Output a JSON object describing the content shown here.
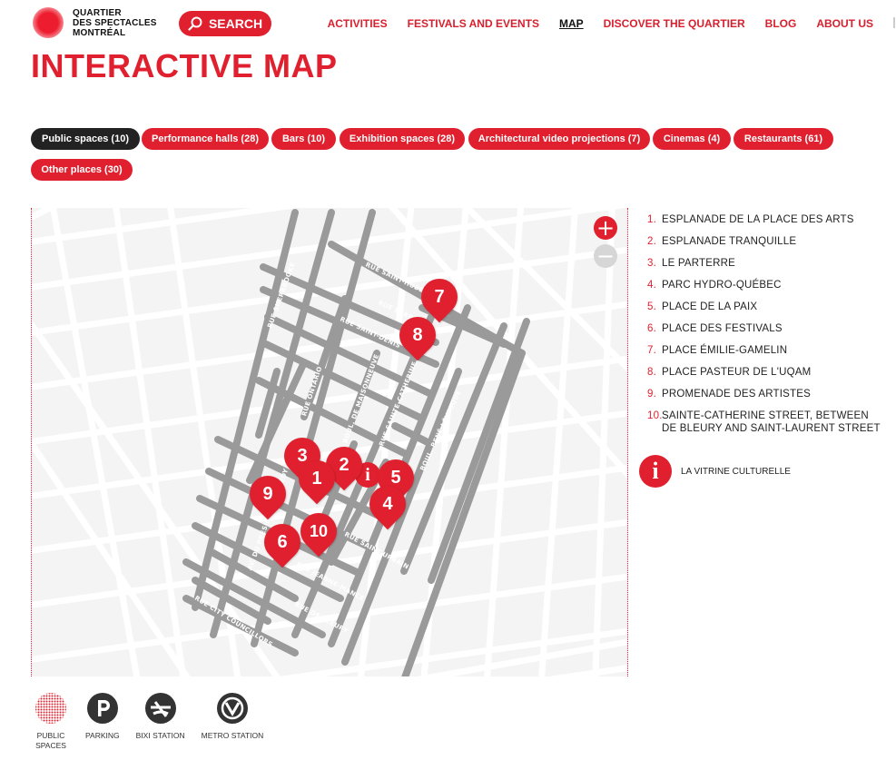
{
  "header": {
    "logo": {
      "line1": "QUARTIER",
      "line2": "DES SPECTACLES",
      "line3": "MONTRÉAL"
    },
    "search_label": "SEARCH",
    "nav": [
      {
        "label": "ACTIVITIES",
        "active": false
      },
      {
        "label": "FESTIVALS AND EVENTS",
        "active": false
      },
      {
        "label": "MAP",
        "active": true
      },
      {
        "label": "DISCOVER THE QUARTIER",
        "active": false
      },
      {
        "label": "BLOG",
        "active": false
      },
      {
        "label": "ABOUT US",
        "active": false
      }
    ]
  },
  "page_title": "INTERACTIVE MAP",
  "filters": [
    {
      "label": "Public spaces (10)",
      "active": true
    },
    {
      "label": "Performance halls (28)",
      "active": false
    },
    {
      "label": "Bars (10)",
      "active": false
    },
    {
      "label": "Exhibition spaces (28)",
      "active": false
    },
    {
      "label": "Architectural video projections (7)",
      "active": false
    },
    {
      "label": "Cinemas (4)",
      "active": false
    },
    {
      "label": "Restaurants (61)",
      "active": false
    },
    {
      "label": "Other places (30)",
      "active": false
    }
  ],
  "map": {
    "zoom_in": "+",
    "zoom_out": "−",
    "streets": [
      "RUE SAINT-HUBERT",
      "RUE BERRI",
      "RUE SAINT-DENIS",
      "RUE SHERBROOKE",
      "RUE ONTARIO",
      "BOUL. DE MAISONNEUVE",
      "RUE SAINTE-CATHERINE",
      "BOUL. RENÉ-LÉVESQUE",
      "RUE SAINT-URBAIN",
      "AV. DU PRÉSIDENT-KENNEDY",
      "RUE JEANNE-MANCE",
      "RUE DE BLEURY",
      "RUE CITY COUNCILLORS"
    ],
    "info_marker": "i",
    "pins": [
      "7",
      "8",
      "3",
      "2",
      "1",
      "5",
      "9",
      "4",
      "10",
      "6"
    ]
  },
  "legend": {
    "items": [
      {
        "num": "1.",
        "name": "ESPLANADE DE LA PLACE DES ARTS"
      },
      {
        "num": "2.",
        "name": "ESPLANADE TRANQUILLE"
      },
      {
        "num": "3.",
        "name": "LE PARTERRE"
      },
      {
        "num": "4.",
        "name": "PARC HYDRO-QUÉBEC"
      },
      {
        "num": "5.",
        "name": "PLACE DE LA PAIX"
      },
      {
        "num": "6.",
        "name": "PLACE DES FESTIVALS"
      },
      {
        "num": "7.",
        "name": "PLACE ÉMILIE-GAMELIN"
      },
      {
        "num": "8.",
        "name": "PLACE PASTEUR DE L'UQAM"
      },
      {
        "num": "9.",
        "name": "PROMENADE DES ARTISTES"
      },
      {
        "num": "10.",
        "name": "SAINTE-CATHERINE STREET, BETWEEN DE BLEURY AND SAINT-LAURENT STREET"
      }
    ],
    "vitrine_icon": "i",
    "vitrine_label": "LA VITRINE CULTURELLE"
  },
  "bottom_legend": [
    {
      "label": "PUBLIC SPACES",
      "icon": "dotted-circle-icon"
    },
    {
      "label": "PARKING",
      "icon": "parking-icon"
    },
    {
      "label": "BIXI STATION",
      "icon": "bixi-icon"
    },
    {
      "label": "METRO STATION",
      "icon": "metro-icon"
    }
  ],
  "colors": {
    "accent": "#e0202e",
    "dark": "#222222",
    "street": "#9a9a9a",
    "background_streets": "#ffffff"
  }
}
